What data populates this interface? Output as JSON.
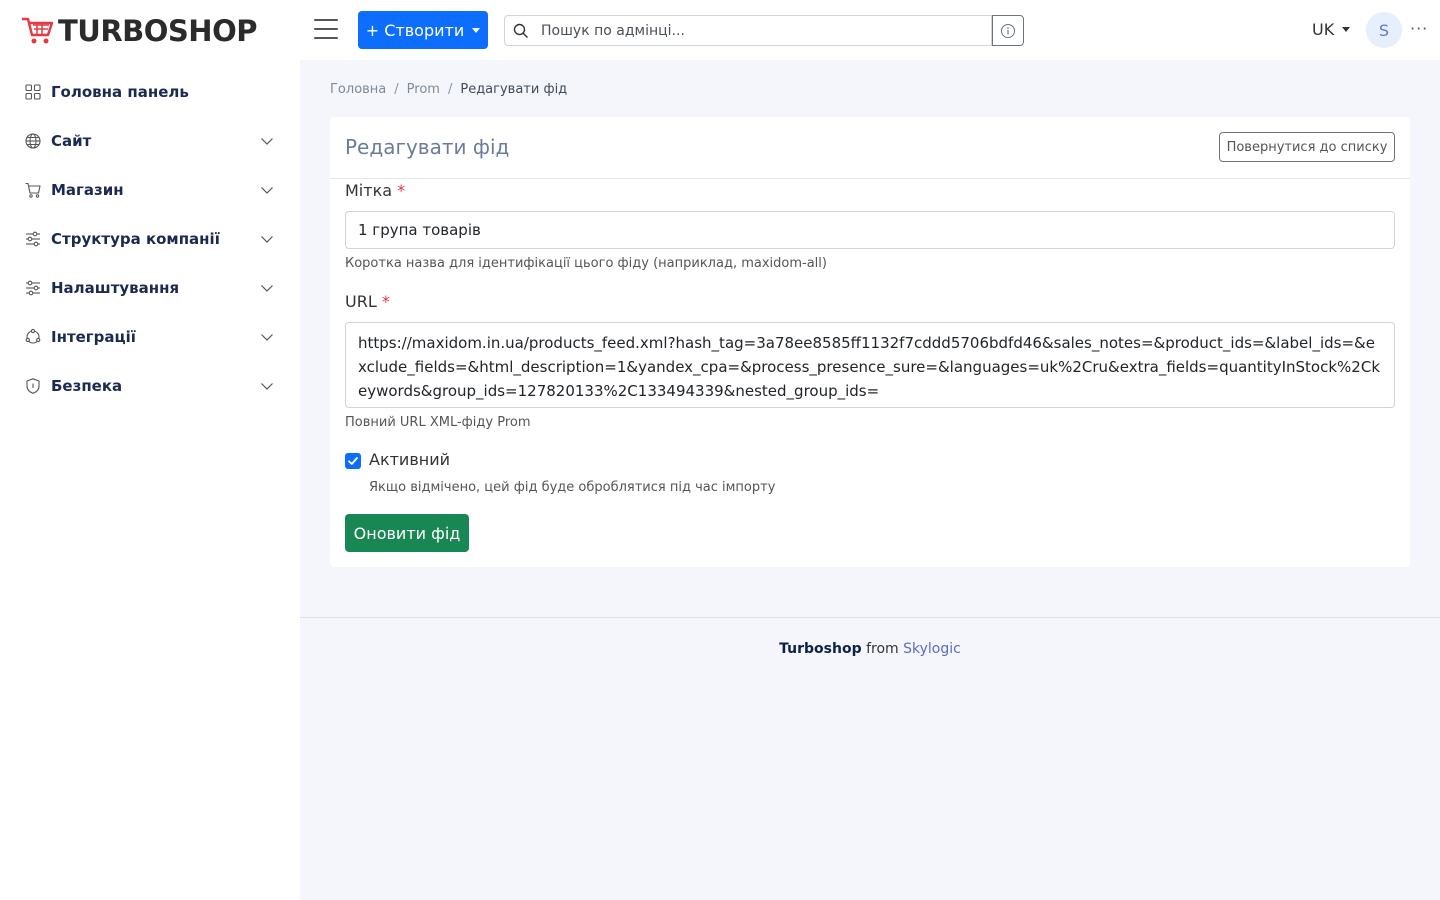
{
  "header": {
    "logo_text": "TURBOSHOP",
    "create_label": "+ Створити",
    "search_placeholder": "Пошук по адмінці...",
    "lang": "UK",
    "avatar_initial": "S",
    "more": "···"
  },
  "sidebar": {
    "items": [
      {
        "label": "Головна панель",
        "icon": "dashboard-grid-icon",
        "expandable": false
      },
      {
        "label": "Сайт",
        "icon": "globe-icon",
        "expandable": true
      },
      {
        "label": "Магазин",
        "icon": "cart-icon",
        "expandable": true
      },
      {
        "label": "Структура компанії",
        "icon": "sliders-icon",
        "expandable": true
      },
      {
        "label": "Налаштування",
        "icon": "settings-sliders-icon",
        "expandable": true
      },
      {
        "label": "Інтеграції",
        "icon": "integrations-icon",
        "expandable": true
      },
      {
        "label": "Безпека",
        "icon": "shield-icon",
        "expandable": true
      }
    ]
  },
  "breadcrumb": {
    "home": "Головна",
    "sep": "/",
    "section": "Prom",
    "current": "Редагувати фід"
  },
  "card": {
    "title": "Редагувати фід",
    "back_label": "Повернутися до списку"
  },
  "form": {
    "label_field": {
      "label": "Мітка",
      "required": "*",
      "value": "1 група товарів",
      "help": "Коротка назва для ідентифікації цього фіду (наприклад, maxidom-all)"
    },
    "url_field": {
      "label": "URL",
      "required": "*",
      "value": "https://maxidom.in.ua/products_feed.xml?hash_tag=3a78ee8585ff1132f7cddd5706bdfd46&sales_notes=&product_ids=&label_ids=&exclude_fields=&html_description=1&yandex_cpa=&process_presence_sure=&languages=uk%2Cru&extra_fields=quantityInStock%2Ckeywords&group_ids=127820133%2C133494339&nested_group_ids=",
      "help": "Повний URL XML-фіду Prom"
    },
    "active": {
      "checked": true,
      "label": "Активний",
      "help": "Якщо відмічено, цей фід буде оброблятися під час імпорту"
    },
    "submit_label": "Оновити фід"
  },
  "footer": {
    "brand": "Turboshop",
    "from": "from",
    "company": "Skylogic"
  },
  "colors": {
    "primary": "#0d6efd",
    "success": "#198754",
    "required": "#dc3545",
    "nav_text": "#1b2a4e"
  }
}
